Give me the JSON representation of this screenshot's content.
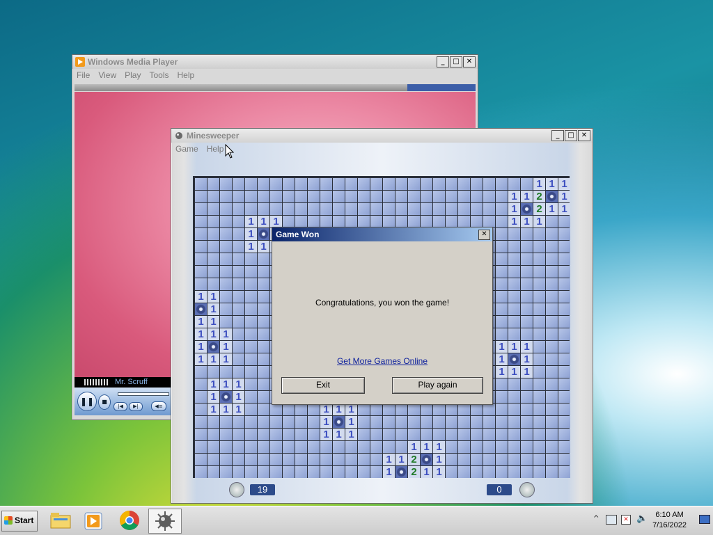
{
  "wmp": {
    "title": "Windows Media Player",
    "menu": [
      "File",
      "View",
      "Play",
      "Tools",
      "Help"
    ],
    "now_playing": "Mr. Scruff"
  },
  "minesweeper": {
    "title": "Minesweeper",
    "menu": [
      "Game",
      "Help"
    ],
    "timer": "19",
    "mines_left": "0",
    "grid": {
      "rows": 24,
      "cols": 30,
      "numbers": [
        [
          0,
          27,
          "1"
        ],
        [
          0,
          28,
          "1"
        ],
        [
          0,
          29,
          "1"
        ],
        [
          1,
          25,
          "1"
        ],
        [
          1,
          26,
          "1"
        ],
        [
          1,
          27,
          "2"
        ],
        [
          1,
          29,
          "1"
        ],
        [
          2,
          25,
          "1"
        ],
        [
          2,
          27,
          "2"
        ],
        [
          2,
          28,
          "1"
        ],
        [
          2,
          29,
          "1"
        ],
        [
          3,
          4,
          "1"
        ],
        [
          3,
          5,
          "1"
        ],
        [
          3,
          6,
          "1"
        ],
        [
          3,
          25,
          "1"
        ],
        [
          3,
          26,
          "1"
        ],
        [
          3,
          27,
          "1"
        ],
        [
          4,
          4,
          "1"
        ],
        [
          4,
          6,
          "1"
        ],
        [
          5,
          4,
          "1"
        ],
        [
          5,
          5,
          "1"
        ],
        [
          5,
          6,
          "1"
        ],
        [
          9,
          0,
          "1"
        ],
        [
          9,
          1,
          "1"
        ],
        [
          10,
          1,
          "1"
        ],
        [
          11,
          0,
          "1"
        ],
        [
          11,
          1,
          "1"
        ],
        [
          12,
          0,
          "1"
        ],
        [
          12,
          1,
          "1"
        ],
        [
          12,
          2,
          "1"
        ],
        [
          13,
          0,
          "1"
        ],
        [
          13,
          2,
          "1"
        ],
        [
          14,
          0,
          "1"
        ],
        [
          14,
          1,
          "1"
        ],
        [
          14,
          2,
          "1"
        ],
        [
          13,
          24,
          "1"
        ],
        [
          13,
          25,
          "1"
        ],
        [
          13,
          26,
          "1"
        ],
        [
          14,
          24,
          "1"
        ],
        [
          14,
          26,
          "1"
        ],
        [
          15,
          24,
          "1"
        ],
        [
          15,
          25,
          "1"
        ],
        [
          15,
          26,
          "1"
        ],
        [
          16,
          1,
          "1"
        ],
        [
          16,
          2,
          "1"
        ],
        [
          16,
          3,
          "1"
        ],
        [
          17,
          1,
          "1"
        ],
        [
          17,
          3,
          "1"
        ],
        [
          18,
          1,
          "1"
        ],
        [
          18,
          2,
          "1"
        ],
        [
          18,
          3,
          "1"
        ],
        [
          18,
          10,
          "1"
        ],
        [
          18,
          11,
          "1"
        ],
        [
          18,
          12,
          "1"
        ],
        [
          19,
          10,
          "1"
        ],
        [
          19,
          12,
          "1"
        ],
        [
          20,
          10,
          "1"
        ],
        [
          20,
          11,
          "1"
        ],
        [
          20,
          12,
          "1"
        ],
        [
          21,
          17,
          "1"
        ],
        [
          21,
          18,
          "1"
        ],
        [
          21,
          19,
          "1"
        ],
        [
          22,
          15,
          "1"
        ],
        [
          22,
          16,
          "1"
        ],
        [
          22,
          17,
          "2"
        ],
        [
          22,
          19,
          "1"
        ],
        [
          23,
          15,
          "1"
        ],
        [
          23,
          17,
          "2"
        ],
        [
          23,
          18,
          "1"
        ],
        [
          23,
          19,
          "1"
        ]
      ],
      "mines": [
        [
          1,
          28
        ],
        [
          2,
          26
        ],
        [
          4,
          5
        ],
        [
          10,
          0
        ],
        [
          13,
          1
        ],
        [
          14,
          25
        ],
        [
          17,
          2
        ],
        [
          19,
          11
        ],
        [
          22,
          18
        ],
        [
          23,
          16
        ]
      ]
    }
  },
  "dialog": {
    "title": "Game Won",
    "close": "✕",
    "message": "Congratulations, you won the game!",
    "link": "Get More Games Online",
    "exit": "Exit",
    "play_again": "Play again"
  },
  "taskbar": {
    "start": "Start",
    "time": "6:10 AM",
    "date": "7/16/2022",
    "apps": [
      "folder-icon",
      "media-player-icon",
      "chrome-icon",
      "minesweeper-icon"
    ]
  }
}
